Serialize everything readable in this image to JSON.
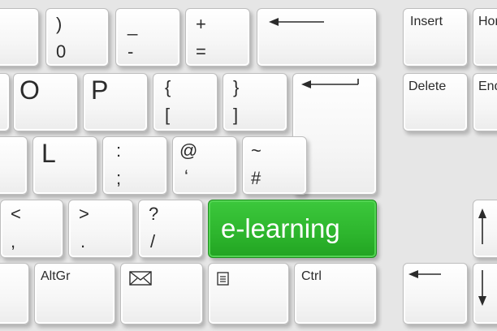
{
  "row1": {
    "k0": {
      "top": ")",
      "bottom": "0"
    },
    "minus": {
      "top": "_",
      "bottom": "-"
    },
    "equals": {
      "top": "+",
      "bottom": "="
    }
  },
  "row2": {
    "o": "O",
    "p": "P",
    "bracket_left": {
      "top": "{",
      "bottom": "["
    },
    "bracket_right": {
      "top": "}",
      "bottom": "]"
    }
  },
  "row3": {
    "l": "L",
    "semicolon": {
      "top": ":",
      "bottom": ";"
    },
    "quote": {
      "top": "@",
      "bottom": "‘"
    },
    "hash": {
      "top": "~",
      "bottom": "#"
    }
  },
  "row4": {
    "comma": {
      "top": "<",
      "bottom": ","
    },
    "period": {
      "top": ">",
      "bottom": "."
    },
    "slash": {
      "top": "?",
      "bottom": "/"
    },
    "highlight": "e-learning"
  },
  "row5": {
    "altgr": "AltGr",
    "mail_icon": "envelope-icon",
    "menu_icon": "menu-icon",
    "ctrl": "Ctrl"
  },
  "nav": {
    "insert": "Insert",
    "home": "Hor",
    "delete": "Delete",
    "end": "End"
  },
  "colors": {
    "highlight": "#2db52d",
    "key_face": "#f6f6f6",
    "legend": "#2b2b2b"
  }
}
